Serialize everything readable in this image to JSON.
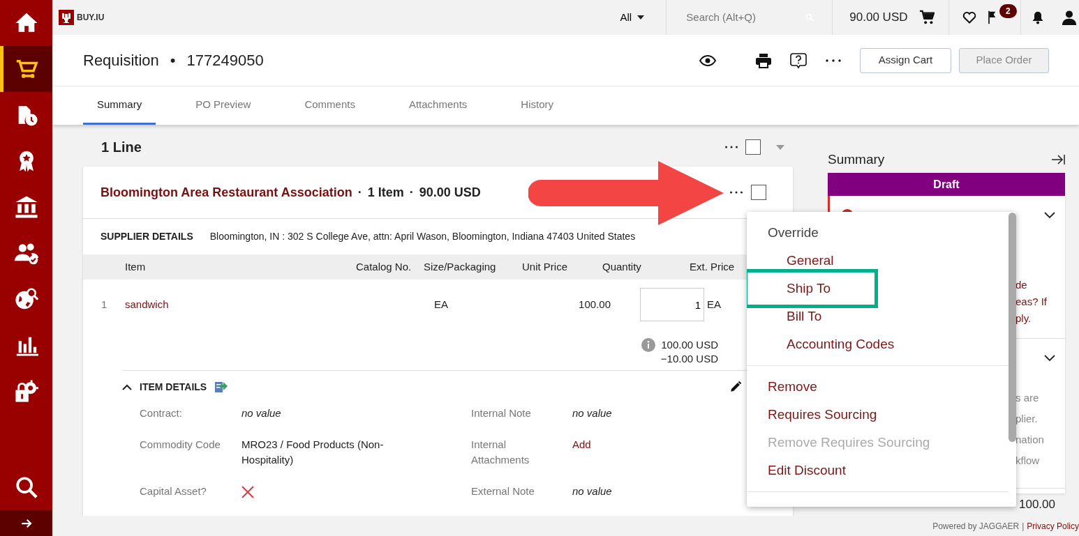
{
  "sidebar": {
    "items": [
      {
        "kind": "home",
        "selected": false
      },
      {
        "kind": "cart",
        "selected": true
      },
      {
        "kind": "document-clock",
        "selected": false
      },
      {
        "kind": "award",
        "selected": false
      },
      {
        "kind": "bank",
        "selected": false
      },
      {
        "kind": "people",
        "selected": false
      },
      {
        "kind": "globe-search",
        "selected": false
      },
      {
        "kind": "chart",
        "selected": false
      },
      {
        "kind": "lock-gear",
        "selected": false
      }
    ],
    "bottom_items": [
      {
        "kind": "search",
        "selected": false
      }
    ]
  },
  "top_bar": {
    "logo_text": "BUY.IU",
    "search_scope": "All",
    "search_placeholder": "Search (Alt+Q)",
    "cart_total": "90.00 USD",
    "flag_count": "2"
  },
  "header": {
    "title": "Requisition",
    "separator": "•",
    "number": "177249050",
    "buttons": [
      {
        "label": "Assign Cart",
        "disabled": false
      },
      {
        "label": "Place Order",
        "disabled": true
      }
    ]
  },
  "tabs": [
    {
      "label": "Summary",
      "selected": true
    },
    {
      "label": "PO Preview",
      "selected": false
    },
    {
      "label": "Comments",
      "selected": false
    },
    {
      "label": "Attachments",
      "selected": false
    },
    {
      "label": "History",
      "selected": false
    }
  ],
  "lines": {
    "title": "1 Line",
    "checked": false
  },
  "supplier_card": {
    "supplier": "Bloomington Area Restaurant Association",
    "separator": "·",
    "item_count": "1 Item",
    "total": "90.00 USD",
    "checked": false,
    "details_label": "SUPPLIER DETAILS",
    "details": "Bloomington, IN : 302 S College Ave, attn: April Wason, Bloomington, Indiana 47403 United States",
    "table": {
      "columns": [
        "Item",
        "Catalog No.",
        "Size/Packaging",
        "Unit Price",
        "Quantity",
        "Ext. Price"
      ],
      "rows": [
        {
          "number": "1",
          "item": "sandwich",
          "size": "EA",
          "unit_price": "100.00",
          "quantity": "1",
          "uom": "EA"
        }
      ]
    },
    "price_lines": [
      "100.00 USD",
      "−10.00 USD"
    ],
    "item_details": {
      "title": "ITEM DETAILS",
      "expanded": true,
      "left": [
        {
          "kind": "text",
          "label": "Contract:",
          "value": "no value",
          "empty": true
        },
        {
          "kind": "text",
          "label": "Commodity Code",
          "value": "MRO23 / Food Products (Non-Hospitality)",
          "empty": false
        },
        {
          "kind": "check",
          "label": "Capital Asset?",
          "checked": false
        }
      ],
      "right": [
        {
          "kind": "text",
          "label": "Internal Note",
          "value": "no value",
          "empty": true
        },
        {
          "kind": "link",
          "label": "Internal Attachments",
          "value": "Add"
        },
        {
          "kind": "text",
          "label": "External Note",
          "value": "no value",
          "empty": true
        }
      ]
    }
  },
  "summary": {
    "title": "Summary",
    "status": "Draft",
    "sections": [
      {
        "alert": true,
        "lines": [
          "de",
          "eas? If",
          "ply."
        ]
      },
      {
        "alert": false,
        "lines": [
          "s are",
          "plier.",
          "nation",
          "kflow"
        ]
      }
    ],
    "subtotal": "100.00"
  },
  "menu": {
    "groups": [
      [
        {
          "label": "Override",
          "kind": "header",
          "disabled": false,
          "highlighted": false
        },
        {
          "label": "General",
          "kind": "sub",
          "disabled": false,
          "highlighted": false
        },
        {
          "label": "Ship To",
          "kind": "sub",
          "disabled": false,
          "highlighted": true
        },
        {
          "label": "Bill To",
          "kind": "sub",
          "disabled": false,
          "highlighted": false
        },
        {
          "label": "Accounting Codes",
          "kind": "sub",
          "disabled": false,
          "highlighted": false
        }
      ],
      [
        {
          "label": "Remove",
          "kind": "item",
          "disabled": false,
          "highlighted": false
        },
        {
          "label": "Requires Sourcing",
          "kind": "item",
          "disabled": false,
          "highlighted": false
        },
        {
          "label": "Remove Requires Sourcing",
          "kind": "item",
          "disabled": true,
          "highlighted": false
        },
        {
          "label": "Edit Discount",
          "kind": "item",
          "disabled": false,
          "highlighted": false
        }
      ]
    ]
  },
  "footer": {
    "powered_by": "Powered by JAGGAER",
    "separator": "|",
    "link": "Privacy Policy"
  }
}
